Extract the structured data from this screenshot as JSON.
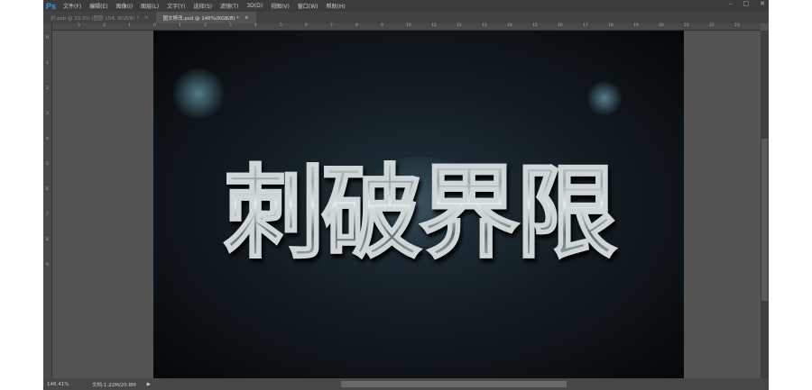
{
  "app": {
    "logo": "Ps"
  },
  "menu": [
    "文件(F)",
    "编辑(E)",
    "图像(I)",
    "图层(L)",
    "文字(Y)",
    "选择(S)",
    "滤镜(T)",
    "3D(D)",
    "视图(V)",
    "窗口(W)",
    "帮助(H)"
  ],
  "window_buttons": [
    "–",
    "□",
    "✕"
  ],
  "tabs": [
    {
      "label": "坑.psb @ 33.3% (图层 154, RGB/8) *",
      "close": "×",
      "active": false
    },
    {
      "label": "图文移改.psd @ 146%(RGB/8) *",
      "close": "×",
      "active": true
    }
  ],
  "ruler_top": [
    "3",
    "2",
    "1",
    "0",
    "1",
    "2",
    "3",
    "4",
    "5",
    "6",
    "7",
    "8",
    "9",
    "10",
    "11",
    "12",
    "13",
    "14",
    "15",
    "16",
    "17",
    "18",
    "19",
    "20",
    "21",
    "22",
    "23"
  ],
  "ruler_left": [
    "0",
    "1",
    "2",
    "3",
    "4",
    "5",
    "6",
    "7",
    "8",
    "9"
  ],
  "canvas": {
    "text": "刺破界限"
  },
  "status": {
    "zoom": "146.41%",
    "doc": "文档:1.22M/20.8M",
    "arrow": "▶"
  }
}
